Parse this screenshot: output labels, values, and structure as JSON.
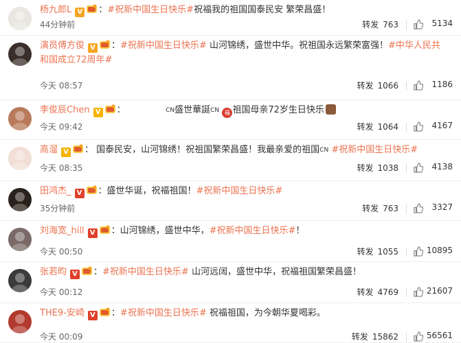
{
  "posts": [
    {
      "user": "杨九郎L",
      "segments": [
        {
          "text": "：",
          "topic": false
        },
        {
          "text": "#祝新中国生日快乐#",
          "topic": true
        },
        {
          "text": "祝福我的祖国国泰民安 繁荣昌盛！",
          "topic": false
        }
      ],
      "time": "44分钟前",
      "repost_label": "转发",
      "repost_count": "763",
      "like_count": "5134"
    },
    {
      "user": "演员傅方俊",
      "segments": [
        {
          "text": "：",
          "topic": false
        },
        {
          "text": "#祝新中国生日快乐#",
          "topic": true
        },
        {
          "text": " 山河锦绣，盛世中华。祝祖国永远繁荣富强！",
          "topic": false
        },
        {
          "text": "#中华人民共和国成立72周年#",
          "topic": true
        }
      ],
      "time": "今天 08:57",
      "repost_label": "转发",
      "repost_count": "1066",
      "like_count": "1186"
    },
    {
      "user": "李俊辰Chen",
      "segments": [
        {
          "text": "：",
          "topic": false
        },
        {
          "text": "　　　　　",
          "topic": false
        },
        {
          "text": "CN",
          "topic": false,
          "small": true
        },
        {
          "text": "盛世華誕",
          "topic": false
        },
        {
          "text": "CN",
          "topic": false,
          "small": true
        },
        {
          "text": " ",
          "topic": false
        },
        {
          "text": "祖国母亲72岁生日快乐",
          "topic": false
        }
      ],
      "time": "今天 09:42",
      "repost_label": "转发",
      "repost_count": "1064",
      "like_count": "4167"
    },
    {
      "user": "高溜",
      "segments": [
        {
          "text": "： 国泰民安，山河锦绣！祝祖国繁荣昌盛！我最亲爱的祖国",
          "topic": false
        },
        {
          "text": "CN",
          "topic": false,
          "small": true
        },
        {
          "text": " ",
          "topic": false
        },
        {
          "text": "#祝新中国生日快乐#",
          "topic": true
        }
      ],
      "time": "今天 08:35",
      "repost_label": "转发",
      "repost_count": "1038",
      "like_count": "4138"
    },
    {
      "user": "田鸿杰_",
      "segments": [
        {
          "text": "：盛世华诞，祝福祖国！",
          "topic": false
        },
        {
          "text": "#祝新中国生日快乐#",
          "topic": true
        }
      ],
      "time": "35分钟前",
      "repost_label": "转发",
      "repost_count": "763",
      "like_count": "3327"
    },
    {
      "user": "刘海宽_hill",
      "segments": [
        {
          "text": "：山河锦绣，盛世中华，",
          "topic": false
        },
        {
          "text": "#祝新中国生日快乐#",
          "topic": true
        },
        {
          "text": "！",
          "topic": false
        }
      ],
      "time": "今天 00:50",
      "repost_label": "转发",
      "repost_count": "1055",
      "like_count": "10895"
    },
    {
      "user": "张若昀",
      "segments": [
        {
          "text": "：",
          "topic": false
        },
        {
          "text": "#祝新中国生日快乐#",
          "topic": true
        },
        {
          "text": " 山河远阔，盛世中华，祝福祖国繁荣昌盛！",
          "topic": false
        }
      ],
      "time": "今天 00:12",
      "repost_label": "转发",
      "repost_count": "4769",
      "like_count": "21607"
    },
    {
      "user": "THE9-安崎",
      "segments": [
        {
          "text": "：",
          "topic": false
        },
        {
          "text": "#祝新中国生日快乐#",
          "topic": true
        },
        {
          "text": " 祝福祖国，为今朝华夏喝彩。",
          "topic": false
        }
      ],
      "time": "今天 00:09",
      "repost_label": "转发",
      "repost_count": "15862",
      "like_count": "56561"
    }
  ],
  "colors": {
    "username": "#eb7350",
    "topic": "#eb7350",
    "badge_gold": "#f5a623",
    "badge_red": "#e0402a"
  }
}
